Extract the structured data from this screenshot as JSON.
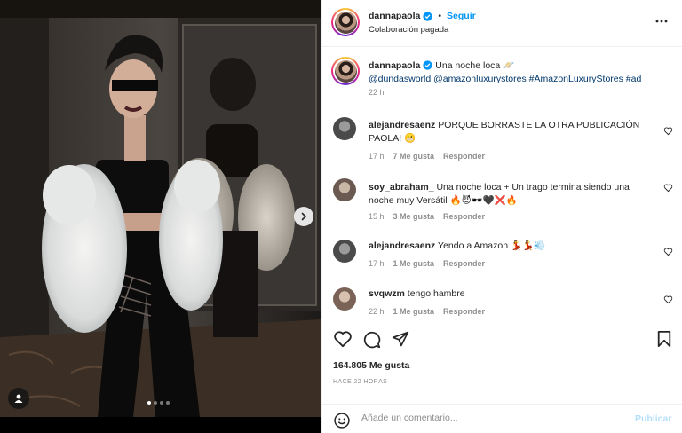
{
  "post": {
    "author": "dannapaola",
    "verified": true,
    "follow_label": "Seguir",
    "separator": "•",
    "subtitle": "Colaboración pagada",
    "slide_count": 4,
    "active_slide": 1
  },
  "caption": {
    "author": "dannapaola",
    "text": "Una noche loca 🪐",
    "tags": "@dundasworld @amazonluxurystores #AmazonLuxuryStores #ad",
    "time": "22 h"
  },
  "comments": [
    {
      "user": "alejandresaenz",
      "text": "PORQUE BORRASTE LA OTRA PUBLICACIÓN PAOLA! 😬",
      "time": "17 h",
      "likes": "7 Me gusta",
      "reply": "Responder"
    },
    {
      "user": "soy_abraham_",
      "text": "Una noche loca + Un trago termina siendo una noche muy Versátil 🔥😈🕶️🖤❌🔥",
      "time": "15 h",
      "likes": "3 Me gusta",
      "reply": "Responder"
    },
    {
      "user": "alejandresaenz",
      "text": "Yendo a Amazon 💃💃💨",
      "time": "17 h",
      "likes": "1 Me gusta",
      "reply": "Responder"
    },
    {
      "user": "svqwzm",
      "text": "tengo hambre",
      "time": "22 h",
      "likes": "1 Me gusta",
      "reply": "Responder"
    }
  ],
  "stats": {
    "likes": "164.805 Me gusta",
    "ago": "HACE 22 HORAS"
  },
  "composer": {
    "placeholder": "Añade un comentario...",
    "publish_label": "Publicar"
  },
  "colors": {
    "accent": "#0095f6",
    "verified": "#0095f6",
    "link": "#00376b",
    "muted": "#8e8e8e",
    "publish_disabled": "#b2dffc"
  },
  "icons": [
    "chevron-right-icon",
    "tag-person-icon",
    "more-icon",
    "verified-icon",
    "heart-icon",
    "comment-icon",
    "share-icon",
    "bookmark-icon",
    "emoji-icon"
  ]
}
